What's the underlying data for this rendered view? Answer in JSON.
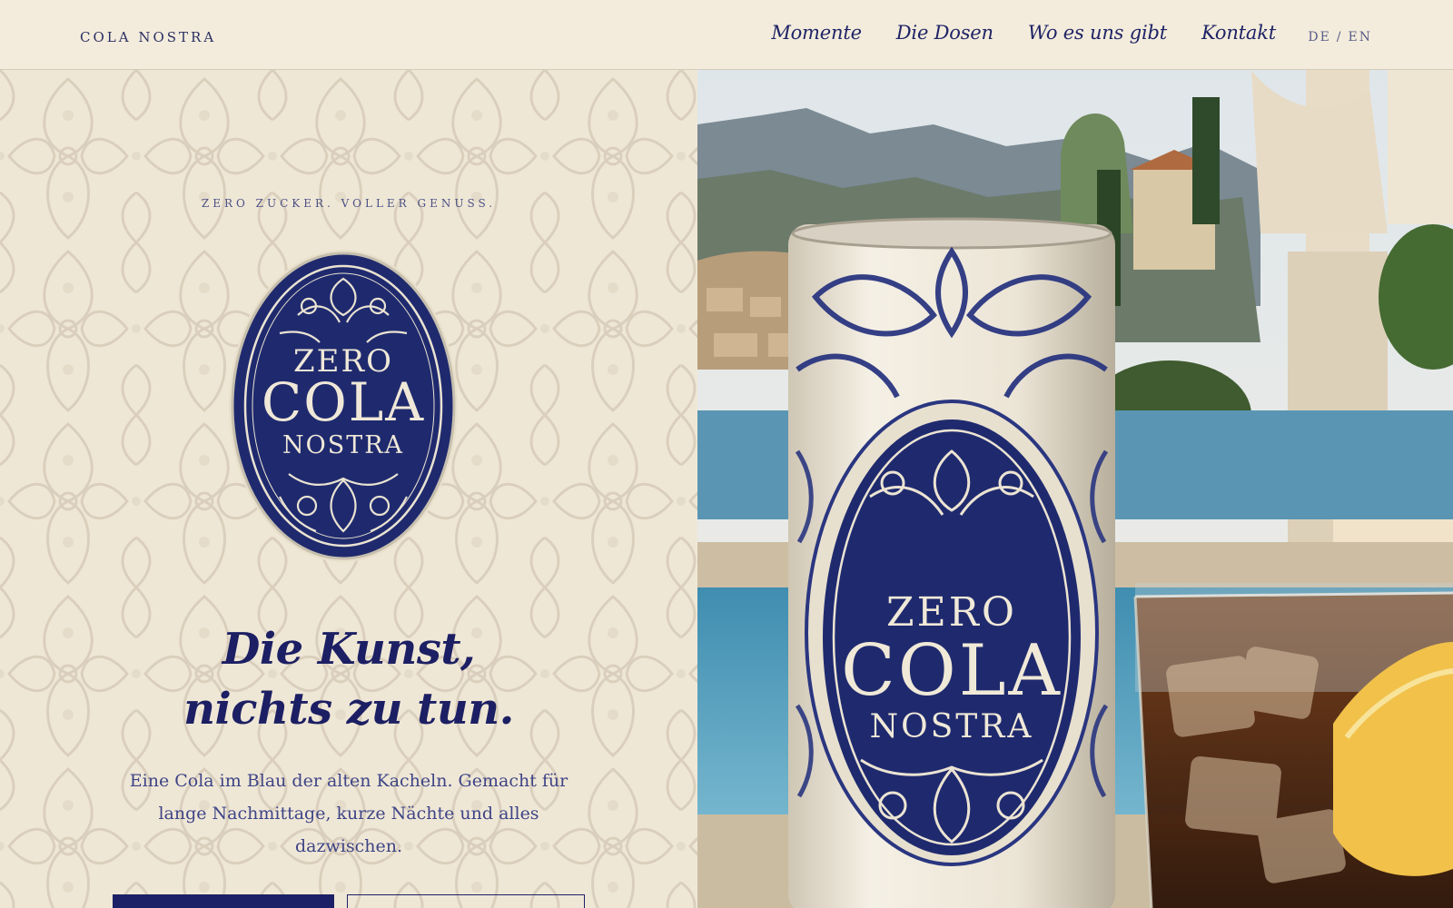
{
  "header": {
    "brand": "COLA NOSTRA",
    "nav": [
      "Momente",
      "Die Dosen",
      "Wo es uns gibt",
      "Kontakt"
    ],
    "lang": {
      "de": "DE",
      "sep": "/",
      "en": "EN"
    }
  },
  "hero": {
    "tagline": "ZERO ZUCKER. VOLLER GENUSS.",
    "badge": {
      "line1": "ZERO",
      "line2": "COLA",
      "line3": "NOSTRA"
    },
    "headline_line1": "Die Kunst,",
    "headline_line2": "nichts zu tun.",
    "lede": "Eine Cola im Blau der alten Kacheln. Gemacht für lange Nachmittage, kurze Nächte und alles dazwischen.",
    "cta_primary": "",
    "cta_secondary": ""
  },
  "photo": {
    "can": {
      "line1": "ZERO",
      "line2": "COLA",
      "line3": "NOSTRA"
    }
  },
  "colors": {
    "cream": "#f3ecdc",
    "navy": "#1c2066",
    "tile_blue": "#1d2a6e"
  }
}
